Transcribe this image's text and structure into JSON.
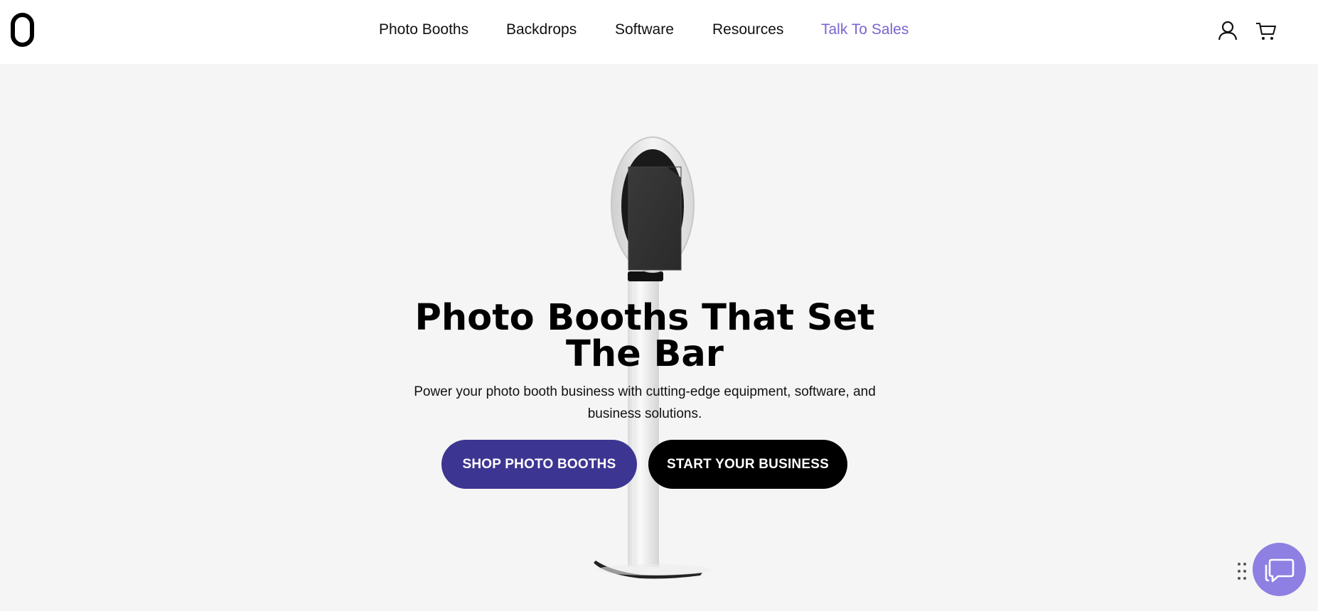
{
  "header": {
    "logo_alt": "0",
    "nav": [
      {
        "label": "Photo Booths"
      },
      {
        "label": "Backdrops"
      },
      {
        "label": "Software"
      },
      {
        "label": "Resources"
      },
      {
        "label": "Talk To Sales"
      }
    ],
    "icons": [
      "account-icon",
      "cart-icon"
    ],
    "accent_color": "#7b63d1"
  },
  "hero": {
    "title": "Photo Booths That Set The Bar",
    "subtitle": "Power your photo booth business with cutting-edge equipment, software, and business solutions.",
    "primary_cta": "SHOP PHOTO BOOTHS",
    "secondary_cta": "START YOUR BUSINESS",
    "primary_color": "#3d3592",
    "secondary_color": "#000000"
  },
  "chat": {
    "icon": "chat-icon",
    "color": "#8e7fe3"
  }
}
